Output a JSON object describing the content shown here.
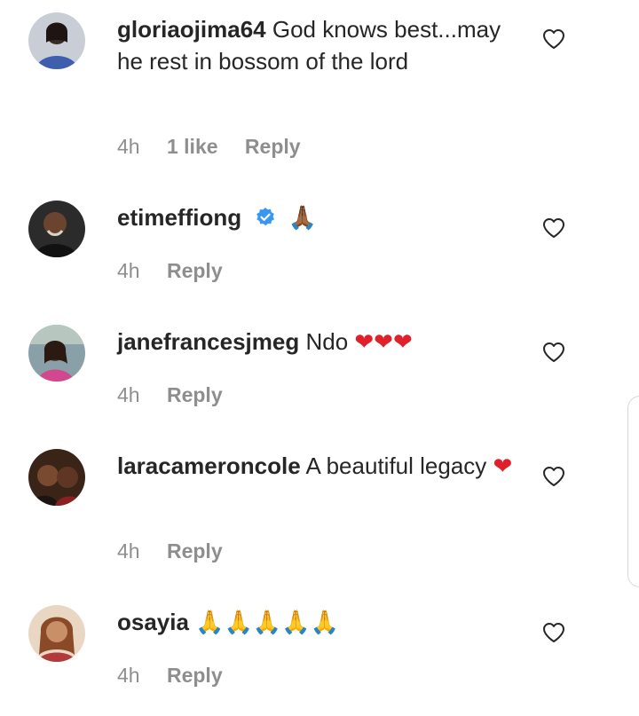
{
  "comments": [
    {
      "username": "gloriaojima64",
      "text": "God knows best...may he rest in bossom of the lord",
      "emoji": "",
      "time": "4h",
      "likes": "1 like",
      "reply": "Reply",
      "verified": false,
      "avatar_icon": "avatar-gloriaojima64"
    },
    {
      "username": "etimeffiong",
      "text": "",
      "emoji": "🙏🏾",
      "time": "4h",
      "likes": "",
      "reply": "Reply",
      "verified": true,
      "avatar_icon": "avatar-etimeffiong"
    },
    {
      "username": "janefrancesjmeg",
      "text": "Ndo",
      "emoji": "❤❤❤",
      "time": "4h",
      "likes": "",
      "reply": "Reply",
      "verified": false,
      "avatar_icon": "avatar-janefrancesjmeg"
    },
    {
      "username": "laracameroncole",
      "text": "A beautiful legacy",
      "emoji": "❤",
      "time": "4h",
      "likes": "",
      "reply": "Reply",
      "verified": false,
      "avatar_icon": "avatar-laracameroncole"
    },
    {
      "username": "osayia",
      "text": "",
      "emoji": "🙏🙏🙏🙏🙏",
      "time": "4h",
      "likes": "",
      "reply": "Reply",
      "verified": false,
      "avatar_icon": "avatar-osayia"
    }
  ],
  "icons": {
    "like": "heart-outline-icon",
    "verified": "verified-badge-icon"
  },
  "colors": {
    "text": "#262626",
    "meta": "#8e8e8e",
    "heart_emoji": "#e0202a",
    "verified_blue": "#3897f0"
  }
}
